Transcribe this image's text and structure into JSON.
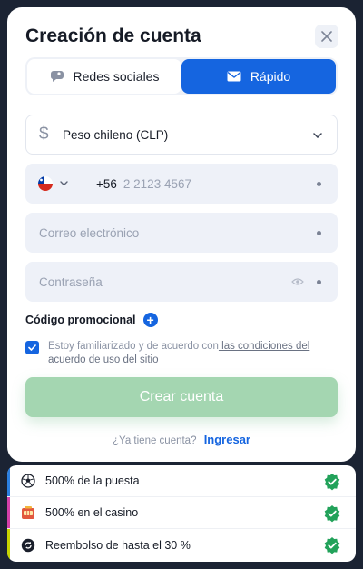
{
  "header": {
    "title": "Creación de cuenta"
  },
  "tabs": [
    {
      "label": "Redes sociales",
      "active": false
    },
    {
      "label": "Rápido",
      "active": true
    }
  ],
  "currency": {
    "label": "Peso chileno (CLP)"
  },
  "phone": {
    "code": "+56",
    "placeholder": "2 2123 4567"
  },
  "email": {
    "placeholder": "Correo electrónico"
  },
  "password": {
    "placeholder": "Contraseña"
  },
  "promo": {
    "label": "Código promocional"
  },
  "agreement": {
    "text": "Estoy familiarizado y de acuerdo con",
    "link": " las condiciones del acuerdo de uso del sitio",
    "checked": true
  },
  "submit": {
    "label": "Crear cuenta"
  },
  "login": {
    "question": "¿Ya tiene cuenta?",
    "link": "Ingresar"
  },
  "bonuses": [
    {
      "label": "500% de la puesta",
      "icon": "soccer-ball-icon",
      "color": "#2b7fe0"
    },
    {
      "label": "500% en el casino",
      "icon": "slot-machine-icon",
      "color": "#d43fa8"
    },
    {
      "label": "Reembolso de hasta el 30 %",
      "icon": "cashback-icon",
      "color": "#c7d400"
    }
  ],
  "colors": {
    "accent": "#1565e0",
    "success": "#22a25a",
    "button_disabled": "#a4d6b1"
  }
}
